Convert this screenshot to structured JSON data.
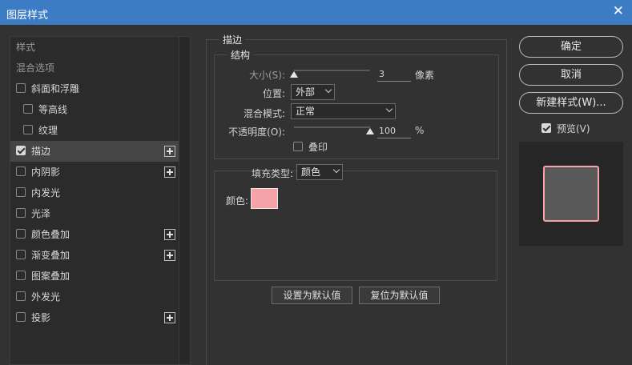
{
  "window": {
    "title": "图层样式",
    "close_glyph": "✕"
  },
  "sidebar": {
    "items": [
      {
        "label": "样式",
        "type": "heading"
      },
      {
        "label": "混合选项",
        "type": "heading"
      },
      {
        "label": "斜面和浮雕",
        "checked": false,
        "plus": false,
        "sub": false
      },
      {
        "label": "等高线",
        "checked": false,
        "plus": false,
        "sub": true
      },
      {
        "label": "纹理",
        "checked": false,
        "plus": false,
        "sub": true
      },
      {
        "label": "描边",
        "checked": true,
        "plus": true,
        "sub": false,
        "selected": true
      },
      {
        "label": "内阴影",
        "checked": false,
        "plus": true,
        "sub": false
      },
      {
        "label": "内发光",
        "checked": false,
        "plus": false,
        "sub": false
      },
      {
        "label": "光泽",
        "checked": false,
        "plus": false,
        "sub": false
      },
      {
        "label": "颜色叠加",
        "checked": false,
        "plus": true,
        "sub": false
      },
      {
        "label": "渐变叠加",
        "checked": false,
        "plus": true,
        "sub": false
      },
      {
        "label": "图案叠加",
        "checked": false,
        "plus": false,
        "sub": false
      },
      {
        "label": "外发光",
        "checked": false,
        "plus": false,
        "sub": false
      },
      {
        "label": "投影",
        "checked": false,
        "plus": true,
        "sub": false
      }
    ]
  },
  "stroke": {
    "section_title": "描边",
    "structure_title": "结构",
    "size_label": "大小(S):",
    "size_value": "3",
    "size_unit": "像素",
    "size_fraction": 0.0,
    "position_label": "位置:",
    "position_value": "外部",
    "blend_label": "混合模式:",
    "blend_value": "正常",
    "opacity_label": "不透明度(O):",
    "opacity_value": "100",
    "opacity_unit": "%",
    "opacity_fraction": 1.0,
    "overprint_label": "叠印",
    "overprint_checked": false,
    "fill_type_label": "填充类型:",
    "fill_type_value": "颜色",
    "color_label": "颜色:",
    "color": "#f4a4a8",
    "default_btn": "设置为默认值",
    "reset_btn": "复位为默认值"
  },
  "actions": {
    "ok": "确定",
    "cancel": "取消",
    "new_style": "新建样式(W)...",
    "preview_label": "预览(V)",
    "preview_checked": true
  },
  "colors": {
    "accent": "#3c7cc4",
    "preview_fill": "#595959",
    "preview_border": "#f4a4a8"
  }
}
